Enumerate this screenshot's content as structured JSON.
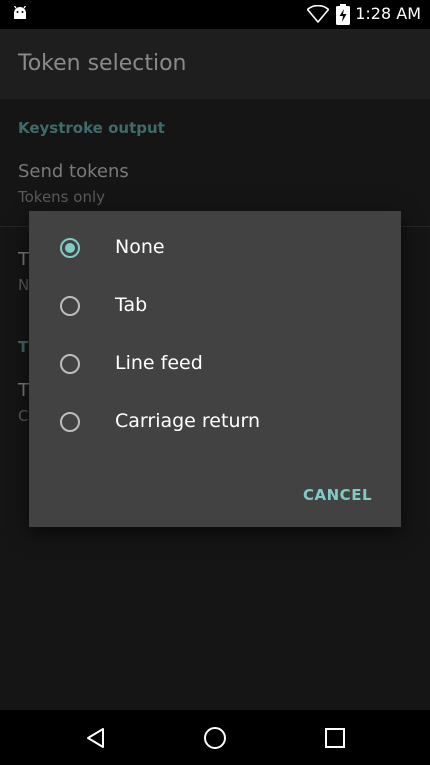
{
  "status_bar": {
    "time": "1:28 AM",
    "icons": [
      "android-icon",
      "wifi-icon",
      "battery-charging-icon"
    ]
  },
  "app_bar": {
    "title": "Token selection"
  },
  "background": {
    "category_1": "Keystroke output",
    "pref_1": {
      "title": "Send tokens",
      "summary": "Tokens only"
    },
    "pref_2": {
      "title": "T",
      "summary": "N"
    },
    "category_2": "T",
    "pref_3": {
      "title": "T",
      "summary": "C"
    }
  },
  "dialog": {
    "options": [
      {
        "label": "None",
        "checked": true
      },
      {
        "label": "Tab",
        "checked": false
      },
      {
        "label": "Line feed",
        "checked": false
      },
      {
        "label": "Carriage return",
        "checked": false
      }
    ],
    "cancel_label": "CANCEL"
  },
  "colors": {
    "accent": "#80cbc4",
    "dialog_bg": "#424242",
    "bar_bg": "#000000"
  },
  "nav_bar": {
    "icons": [
      "back-icon",
      "home-icon",
      "recents-icon"
    ]
  }
}
